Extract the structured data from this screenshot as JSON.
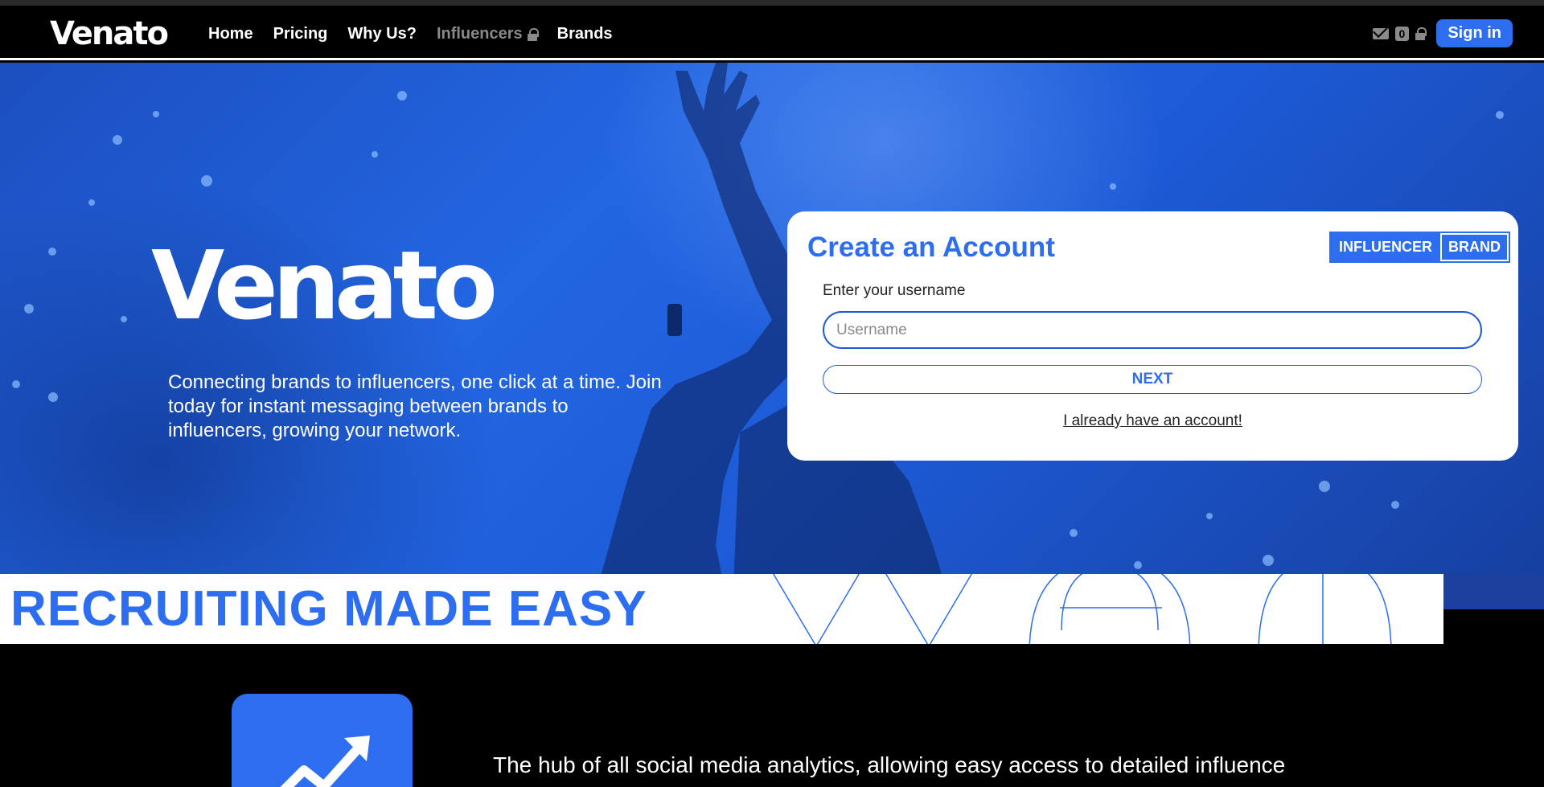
{
  "nav": {
    "logo": "Venato",
    "links": [
      "Home",
      "Pricing",
      "Why Us?",
      "Influencers",
      "Brands"
    ],
    "message_count": "0",
    "sign_in": "Sign in"
  },
  "hero": {
    "logo": "Venato",
    "tagline": "Connecting brands to influencers, one click at a time. Join today for instant messaging between brands to influencers, growing your network."
  },
  "signup": {
    "title": "Create an Account",
    "toggle_influencer": "INFLUENCER",
    "toggle_brand": "BRAND",
    "username_label": "Enter your username",
    "username_placeholder": "Username",
    "next_label": "NEXT",
    "have_account_link": "I already have an account!"
  },
  "banner": {
    "title": "RECRUITING MADE EASY"
  },
  "feature": {
    "icon": "chart-growth-icon",
    "text": "The hub of all social media analytics, allowing easy access to detailed influence"
  },
  "colors": {
    "accent": "#2d6ef0",
    "hero_blue": "#2366e2",
    "navbar": "#000000"
  }
}
